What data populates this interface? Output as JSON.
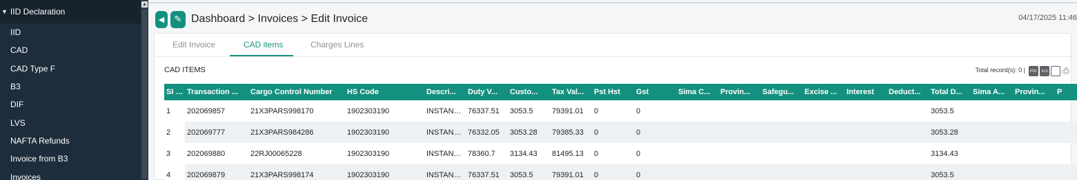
{
  "sidebar": {
    "group_label": "IID Declaration",
    "items": [
      "IID",
      "CAD",
      "CAD Type F",
      "B3",
      "DIF",
      "LVS",
      "NAFTA Refunds",
      "Invoice from B3",
      "Invoices"
    ]
  },
  "header": {
    "breadcrumb": "Dashboard > Invoices > Edit Invoice",
    "datetime": "04/17/2025 11:46"
  },
  "tabs": [
    "Edit Invoice",
    "CAD items",
    "Charges Lines"
  ],
  "section": {
    "title": "CAD ITEMS",
    "records": "Total record(s): 0 |"
  },
  "toolbar": {
    "pdf_label": "PDF",
    "xls_label": "XLS"
  },
  "table": {
    "columns": [
      "SI N...",
      "Transaction ...",
      "Cargo Control Number",
      "HS Code",
      "Descri...",
      "Duty V...",
      "Custo...",
      "Tax Val...",
      "Pst Hst",
      "Gst",
      "Sima C...",
      "Provin...",
      "Safegu...",
      "Excise ...",
      "Interest",
      "Deduct...",
      "Total D...",
      "Sima A...",
      "Provin...",
      "P"
    ],
    "rows": [
      [
        "1",
        "202069857",
        "21X3PARS998170",
        "1902303190",
        "INSTANT ...",
        "76337.51",
        "3053.5",
        "79391.01",
        "0",
        "0",
        "",
        "",
        "",
        "",
        "",
        "",
        "3053.5",
        "",
        "",
        ""
      ],
      [
        "2",
        "202069777",
        "21X3PARS984286",
        "1902303190",
        "INSTANT ...",
        "76332.05",
        "3053.28",
        "79385.33",
        "0",
        "0",
        "",
        "",
        "",
        "",
        "",
        "",
        "3053.28",
        "",
        "",
        ""
      ],
      [
        "3",
        "202069880",
        "22RJ00065228",
        "1902303190",
        "INSTANT ...",
        "78360.7",
        "3134.43",
        "81495.13",
        "0",
        "0",
        "",
        "",
        "",
        "",
        "",
        "",
        "3134.43",
        "",
        "",
        ""
      ],
      [
        "4",
        "202069879",
        "21X3PARS998174",
        "1902303190",
        "INSTANT ...",
        "76337.51",
        "3053.5",
        "79391.01",
        "0",
        "0",
        "",
        "",
        "",
        "",
        "",
        "",
        "3053.5",
        "",
        "",
        ""
      ]
    ]
  },
  "colors": {
    "accent": "#14907f",
    "sidebar": "#1d2d3b"
  },
  "icons": [
    "back-chevron-icon",
    "edit-pencil-icon",
    "pdf-icon",
    "xls-icon",
    "save-icon",
    "print-icon"
  ]
}
